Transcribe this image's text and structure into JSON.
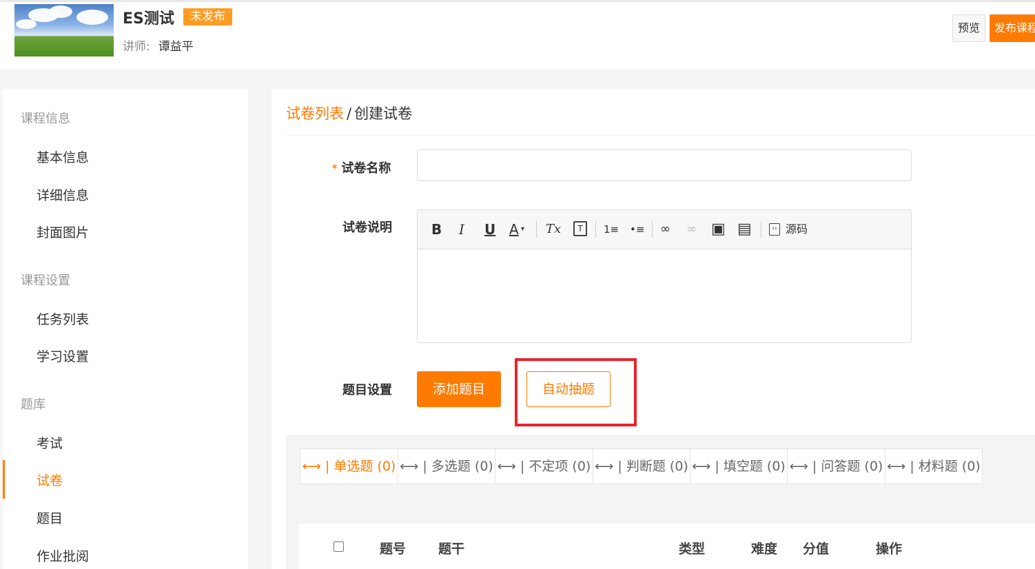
{
  "header": {
    "course_title": "ES测试",
    "status_badge": "未发布",
    "teacher_label": "讲师:",
    "teacher_name": "谭益平",
    "preview_label": "预览",
    "publish_label": "发布课程"
  },
  "sidebar": {
    "groups": [
      {
        "title": "课程信息",
        "items": [
          "基本信息",
          "详细信息",
          "封面图片"
        ]
      },
      {
        "title": "课程设置",
        "items": [
          "任务列表",
          "学习设置"
        ]
      },
      {
        "title": "题库",
        "items": [
          "考试",
          "试卷",
          "题目",
          "作业批阅"
        ]
      }
    ],
    "active_item": "试卷"
  },
  "breadcrumb": {
    "link": "试卷列表",
    "separator": "/",
    "current": "创建试卷"
  },
  "form": {
    "name_label": "试卷名称",
    "required_mark": "*",
    "name_value": "",
    "desc_label": "试卷说明",
    "question_settings_label": "题目设置",
    "add_question_button": "添加题目",
    "auto_draw_button": "自动抽题"
  },
  "editor": {
    "toolbar": [
      {
        "icon": "bold-icon",
        "glyph": "B"
      },
      {
        "icon": "italic-icon",
        "glyph": "I"
      },
      {
        "icon": "underline-icon",
        "glyph": "U"
      },
      {
        "icon": "font-color-icon",
        "glyph": "A"
      },
      {
        "icon": "clear-format-icon",
        "glyph": "Tx"
      },
      {
        "icon": "paste-text-icon",
        "glyph": "T"
      },
      {
        "icon": "ordered-list-icon",
        "glyph": "1≡"
      },
      {
        "icon": "bullet-list-icon",
        "glyph": "•≡"
      },
      {
        "icon": "link-icon",
        "glyph": "∞"
      },
      {
        "icon": "unlink-icon",
        "glyph": "∞"
      },
      {
        "icon": "image-icon",
        "glyph": "▣"
      },
      {
        "icon": "table-icon",
        "glyph": "▤"
      },
      {
        "icon": "source-code-icon",
        "glyph": "‹›"
      }
    ],
    "source_label": "源码"
  },
  "question_tabs": [
    {
      "label": "⟷ | 单选题 (0)",
      "active": true
    },
    {
      "label": "⟷ | 多选题 (0)",
      "active": false
    },
    {
      "label": "⟷ | 不定项 (0)",
      "active": false
    },
    {
      "label": "⟷ | 判断题 (0)",
      "active": false
    },
    {
      "label": "⟷ | 填空题 (0)",
      "active": false
    },
    {
      "label": "⟷ | 问答题 (0)",
      "active": false
    },
    {
      "label": "⟷ | 材料题 (0)",
      "active": false
    }
  ],
  "table": {
    "columns": [
      "题号",
      "题干",
      "类型",
      "难度",
      "分值",
      "操作"
    ]
  },
  "colors": {
    "accent": "#ff7a00",
    "badge": "#ff9c24",
    "highlight": "#e8232d"
  }
}
